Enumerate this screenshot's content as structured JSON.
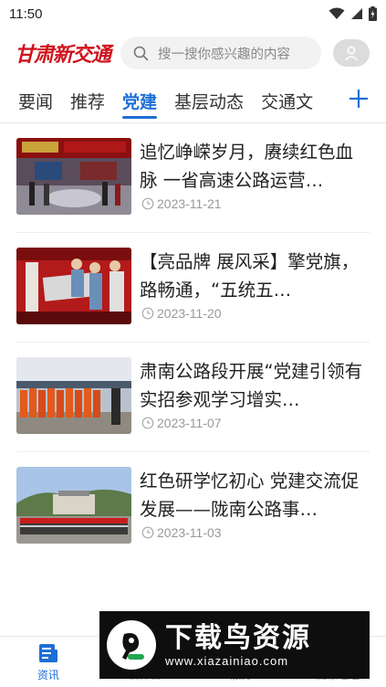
{
  "status_bar": {
    "time": "11:50"
  },
  "header": {
    "logo_text": "甘肃新交通",
    "search_placeholder": "搜一搜你感兴趣的内容",
    "brand_color": "#d0121b"
  },
  "tabs": [
    {
      "label": "要闻",
      "active": false
    },
    {
      "label": "推荐",
      "active": false
    },
    {
      "label": "党建",
      "active": true
    },
    {
      "label": "基层动态",
      "active": false
    },
    {
      "label": "交通文",
      "active": false
    }
  ],
  "accent_color": "#1e6fd6",
  "news": [
    {
      "title": "追忆峥嵘岁月，赓续红色血脉 一省高速公路运营…",
      "date": "2023-11-21"
    },
    {
      "title": "【亮品牌 展风采】擎党旗，路畅通，“五统五…",
      "date": "2023-11-20"
    },
    {
      "title": "肃南公路段开展“党建引领有实招参观学习增实…",
      "date": "2023-11-07"
    },
    {
      "title": "红色研学忆初心 党建交流促发展——陇南公路事…",
      "date": "2023-11-03"
    }
  ],
  "bottom_nav": [
    {
      "label": "资讯",
      "icon": "news-icon",
      "active": true
    },
    {
      "label": "新体验",
      "icon": "compass-icon",
      "active": false
    },
    {
      "label": "服务",
      "icon": "grid-icon",
      "active": false
    },
    {
      "label": "陇原经连",
      "icon": "road-icon",
      "active": false
    }
  ],
  "watermark": {
    "main": "下载鸟资源",
    "sub": "www.xiazainiao.com"
  }
}
